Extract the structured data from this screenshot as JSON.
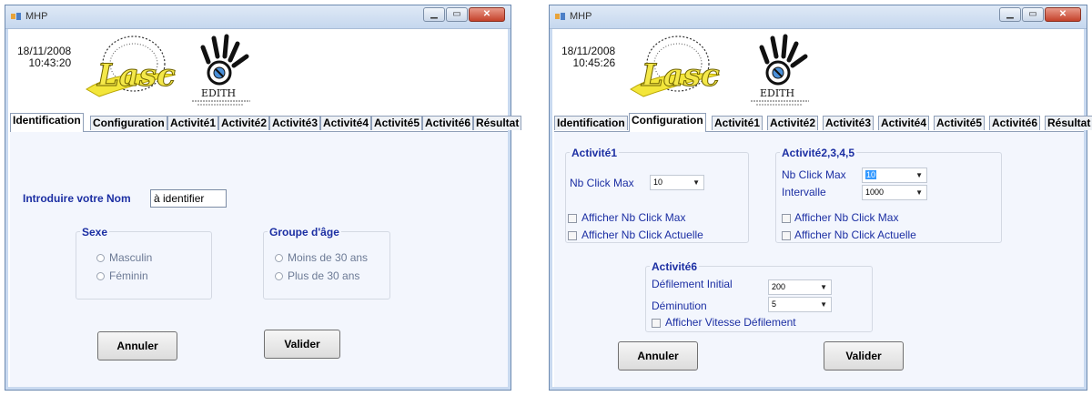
{
  "window1": {
    "title": "MHP",
    "date": "18/11/2008",
    "time": "10:43:20",
    "tabs": [
      "Identification",
      "Configuration",
      "Activité1",
      "Activité2",
      "Activité3",
      "Activité4",
      "Activité5",
      "Activité6",
      "Résultat"
    ],
    "active_tab": "Identification",
    "name_label": "Introduire votre Nom",
    "name_value": "à identifier",
    "sexe": {
      "title": "Sexe",
      "options": [
        "Masculin",
        "Féminin"
      ]
    },
    "age": {
      "title": "Groupe d'âge",
      "options": [
        "Moins de 30 ans",
        "Plus de 30 ans"
      ]
    },
    "cancel_label": "Annuler",
    "ok_label": "Valider"
  },
  "window2": {
    "title": "MHP",
    "date": "18/11/2008",
    "time": "10:45:26",
    "tabs": [
      "Identification",
      "Configuration",
      "Activité1",
      "Activité2",
      "Activité3",
      "Activité4",
      "Activité5",
      "Activité6",
      "Résultat"
    ],
    "active_tab": "Configuration",
    "activite1": {
      "title": "Activité1",
      "nb_click_label": "Nb Click Max",
      "nb_click_value": "10",
      "chk_max": "Afficher Nb Click Max",
      "chk_actuelle": "Afficher Nb Click Actuelle"
    },
    "activite2345": {
      "title": "Activité2,3,4,5",
      "nb_click_label": "Nb Click Max",
      "nb_click_value": "10",
      "intervalle_label": "Intervalle",
      "intervalle_value": "1000",
      "chk_max": "Afficher Nb Click Max",
      "chk_actuelle": "Afficher Nb Click Actuelle"
    },
    "activite6": {
      "title": "Activité6",
      "defilement_label": "Défilement Initial",
      "defilement_value": "200",
      "deminution_label": "Déminution",
      "deminution_value": "5",
      "chk_vitesse": "Afficher Vitesse Défilement"
    },
    "cancel_label": "Annuler",
    "ok_label": "Valider"
  },
  "logos": {
    "lasc": "Lasc",
    "edith": "EDITH"
  },
  "colors": {
    "label_blue": "#1c2fa3",
    "window_frame": "#c9daf0",
    "panel_bg": "#f3f6fd",
    "close_red": "#c4412a"
  }
}
